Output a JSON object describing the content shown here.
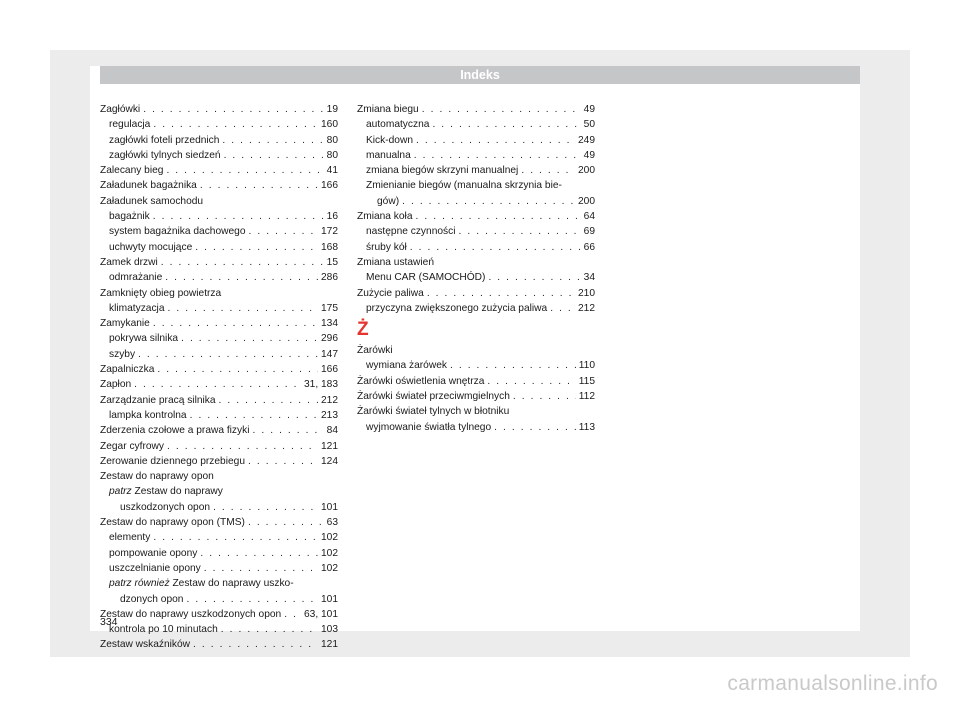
{
  "header": {
    "title": "Indeks"
  },
  "page_number": "334",
  "watermark": "carmanualsonline.info",
  "left_column": [
    {
      "label": "Zagłówki",
      "pages": "19"
    },
    {
      "label": "regulacja",
      "pages": "160"
    },
    {
      "label": "zagłówki foteli przednich",
      "pages": "80"
    },
    {
      "label": "zagłówki tylnych siedzeń",
      "pages": "80"
    },
    {
      "label": "Zalecany bieg",
      "pages": "41"
    },
    {
      "label": "Załadunek bagażnika",
      "pages": "166"
    },
    {
      "label": "Załadunek samochodu"
    },
    {
      "label": "bagażnik",
      "pages": "16"
    },
    {
      "label": "system bagażnika dachowego",
      "pages": "172"
    },
    {
      "label": "uchwyty mocujące",
      "pages": "168"
    },
    {
      "label": "Zamek drzwi",
      "pages": "15"
    },
    {
      "label": "odmrażanie",
      "pages": "286"
    },
    {
      "label": "Zamknięty obieg powietrza"
    },
    {
      "label": "klimatyzacja",
      "pages": "175"
    },
    {
      "label": "Zamykanie",
      "pages": "134"
    },
    {
      "label": "pokrywa silnika",
      "pages": "296"
    },
    {
      "label": "szyby",
      "pages": "147"
    },
    {
      "label": "Zapalniczka",
      "pages": "166"
    },
    {
      "label": "Zapłon",
      "pages": "31, 183"
    },
    {
      "label": "Zarządzanie pracą silnika",
      "pages": "212"
    },
    {
      "label": "lampka kontrolna",
      "pages": "213"
    },
    {
      "label": "Zderzenia czołowe a prawa fizyki",
      "pages": "84"
    },
    {
      "label": "Zegar cyfrowy",
      "pages": "121"
    },
    {
      "label": "Zerowanie dziennego przebiegu",
      "pages": "124"
    },
    {
      "label": "Zestaw do naprawy opon"
    },
    {
      "see": "patrz",
      "label": "Zestaw do naprawy"
    },
    {
      "label": "uszkodzonych opon",
      "pages": "101"
    },
    {
      "label": "Zestaw do naprawy opon (TMS)",
      "pages": "63"
    },
    {
      "label": "elementy",
      "pages": "102"
    },
    {
      "label": "pompowanie opony",
      "pages": "102"
    },
    {
      "label": "uszczelnianie opony",
      "pages": "102"
    },
    {
      "see": "patrz również",
      "label": "Zestaw do naprawy uszko-"
    },
    {
      "label": "dzonych opon",
      "pages": "101"
    },
    {
      "label": "Zestaw do naprawy uszkodzonych opon",
      "pages": "63, 101"
    },
    {
      "label": "kontrola po 10 minutach",
      "pages": "103"
    },
    {
      "label": "Zestaw wskaźników",
      "pages": "121"
    }
  ],
  "right_column_a": [
    {
      "label": "Zmiana biegu",
      "pages": "49"
    },
    {
      "label": "automatyczna",
      "pages": "50"
    },
    {
      "label": "Kick-down",
      "pages": "249"
    },
    {
      "label": "manualna",
      "pages": "49"
    },
    {
      "label": "zmiana biegów skrzyni manualnej",
      "pages": "200"
    },
    {
      "label": "Zmienianie biegów (manualna skrzynia bie-"
    },
    {
      "label": "gów)",
      "pages": "200"
    },
    {
      "label": "Zmiana koła",
      "pages": "64"
    },
    {
      "label": "następne czynności",
      "pages": "69"
    },
    {
      "label": "śruby kół",
      "pages": "66"
    },
    {
      "label": "Zmiana ustawień"
    },
    {
      "label": "Menu CAR (SAMOCHÓD)",
      "pages": "34"
    },
    {
      "label": "Zużycie paliwa",
      "pages": "210"
    },
    {
      "label": "przyczyna zwiększonego zużycia paliwa",
      "pages": "212"
    }
  ],
  "section_letter": "Ż",
  "right_column_b": [
    {
      "label": "Żarówki"
    },
    {
      "label": "wymiana żarówek",
      "pages": "110"
    },
    {
      "label": "Żarówki oświetlenia wnętrza",
      "pages": "115"
    },
    {
      "label": "Żarówki świateł przeciwmgielnych",
      "pages": "112"
    },
    {
      "label": "Żarówki świateł tylnych w błotniku"
    },
    {
      "label": "wyjmowanie światła tylnego",
      "pages": "113"
    }
  ]
}
